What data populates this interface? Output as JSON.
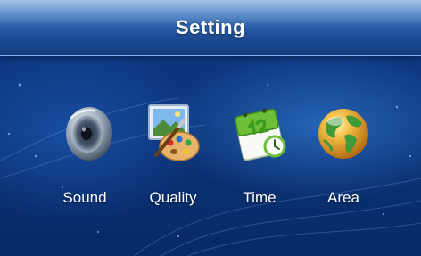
{
  "header": {
    "title": "Setting"
  },
  "menu": {
    "items": [
      {
        "label": "Sound",
        "icon": "speaker-icon"
      },
      {
        "label": "Quality",
        "icon": "palette-icon"
      },
      {
        "label": "Time",
        "icon": "calendar-icon"
      },
      {
        "label": "Area",
        "icon": "globe-icon"
      }
    ]
  },
  "colors": {
    "background": "#0b3479",
    "titlebar_top": "#6f9fd6",
    "titlebar_bottom": "#123c7c",
    "text": "#ffffff"
  }
}
